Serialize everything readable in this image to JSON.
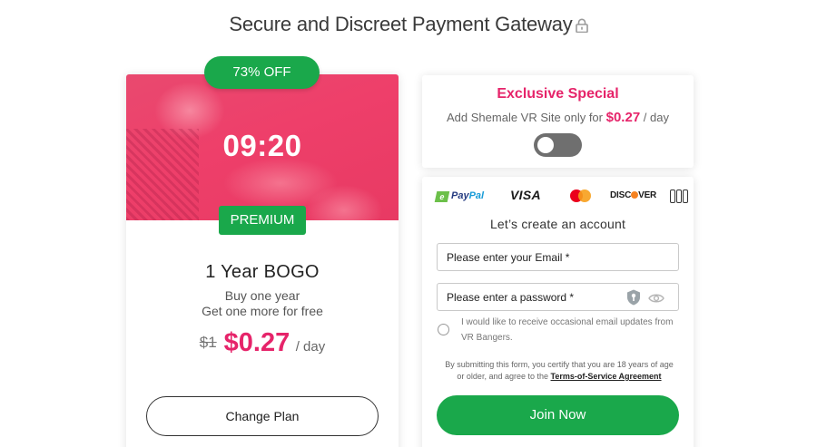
{
  "header": {
    "title": "Secure and Discreet Payment Gateway",
    "lock_icon": "lock-icon"
  },
  "plan": {
    "discount_badge": "73% OFF",
    "timer": "09:20",
    "tier_badge": "PREMIUM",
    "name": "1 Year BOGO",
    "desc_line1": "Buy one year",
    "desc_line2": "Get one more for free",
    "old_price": "$1",
    "price": "$0.27",
    "price_unit": "/ day",
    "change_plan_label": "Change Plan"
  },
  "special": {
    "title": "Exclusive Special",
    "desc_prefix": "Add Shemale VR Site only for",
    "desc_price": "$0.27",
    "desc_suffix": "/ day",
    "toggle_on": false
  },
  "payment_methods": {
    "paypal_e": "e",
    "paypal_pay": "Pay",
    "paypal_pal": "Pal",
    "visa": "VISA",
    "discover_prefix": "DISC",
    "discover_suffix": "VER"
  },
  "form": {
    "heading": "Let’s create an account",
    "email_placeholder": "Please enter your Email *",
    "password_placeholder": "Please enter a password *",
    "newsletter_label": "I would like to receive occasional email updates from VR Bangers.",
    "terms_prefix": "By submitting this form, you certify that you are 18 years of age or older, and agree to the",
    "terms_link": "Terms-of-Service Agreement",
    "submit_label": "Join Now"
  },
  "colors": {
    "accent_pink": "#e6246a",
    "green": "#1aa84b",
    "toggle_off": "#6f6f6f"
  }
}
